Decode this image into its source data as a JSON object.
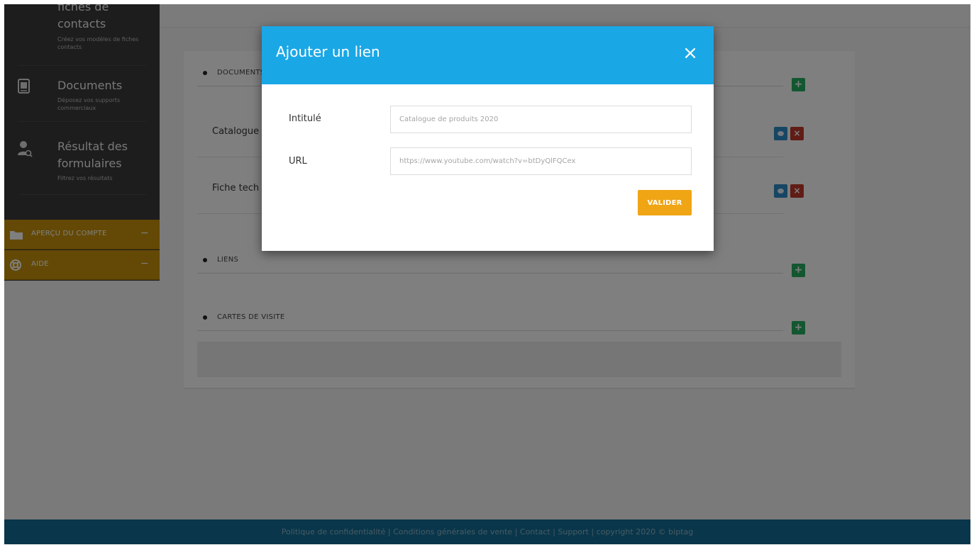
{
  "sidebar": {
    "items": [
      {
        "title": "fiches de contacts",
        "desc": "Créez vos modèles de fiches contacts",
        "icon": "contact-card-icon"
      },
      {
        "title": "Documents",
        "desc": "Déposez vos supports commerciaux",
        "icon": "document-icon"
      },
      {
        "title": "Résultat des formulaires",
        "desc": "Filtrez vos résultats",
        "icon": "user-search-icon"
      }
    ],
    "accordion": [
      {
        "label": "APERÇU DU COMPTE",
        "toggle": "−",
        "icon": "folder-icon"
      },
      {
        "label": "AIDE",
        "toggle": "−",
        "icon": "lifebuoy-icon"
      }
    ]
  },
  "main": {
    "sections": {
      "documents": "DOCUMENTS",
      "links": "LIENS",
      "cards": "CARTES DE VISITE"
    },
    "documents": [
      {
        "name": "Catalogue"
      },
      {
        "name": "Fiche tech"
      }
    ],
    "add_symbol": "+",
    "delete_symbol": "×"
  },
  "modal": {
    "title": "Ajouter un lien",
    "close_symbol": "×",
    "fields": {
      "title_label": "Intitulé",
      "title_placeholder": "Catalogue de produits 2020",
      "url_label": "URL",
      "url_placeholder": "https://www.youtube.com/watch?v=btDyQlFQCex"
    },
    "submit_label": "VALIDER"
  },
  "footer": {
    "privacy": "Politique de confidentialité",
    "terms": "Conditions générales de vente",
    "contact": "Contact",
    "support": "Support",
    "copyright": "copyright 2020 © biptag",
    "separator": " | "
  },
  "colors": {
    "sidebar_bg": "#3a3a3a",
    "accordion_bg": "#c8930c",
    "modal_header": "#1aa7e6",
    "submit": "#f0a515",
    "add": "#27ae60",
    "view": "#2e8cc8",
    "delete": "#c0392b",
    "footer": "#136d94"
  }
}
